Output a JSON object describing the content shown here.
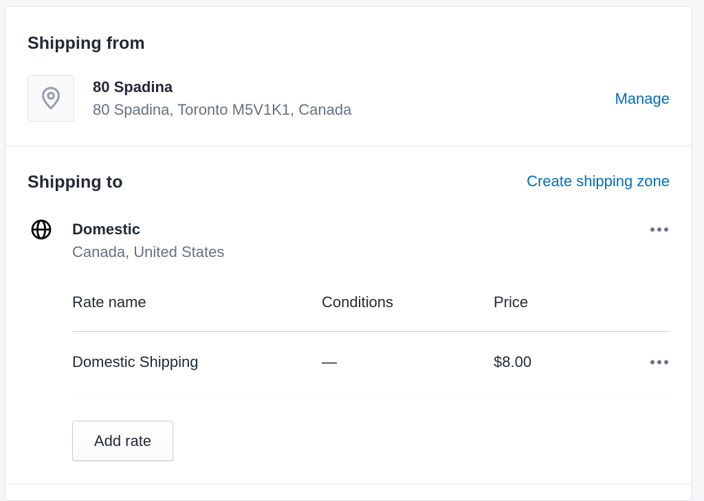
{
  "shipping_from": {
    "heading": "Shipping from",
    "location": {
      "icon": "location-pin-icon",
      "name": "80 Spadina",
      "address": "80 Spadina, Toronto M5V1K1, Canada"
    },
    "manage_label": "Manage"
  },
  "shipping_to": {
    "heading": "Shipping to",
    "create_zone_label": "Create shipping zone",
    "zones": [
      {
        "icon": "globe-icon",
        "name": "Domestic",
        "countries": "Canada, United States",
        "columns": {
          "rate_name": "Rate name",
          "conditions": "Conditions",
          "price": "Price"
        },
        "rates": [
          {
            "name": "Domestic Shipping",
            "conditions": "—",
            "price": "$8.00"
          }
        ],
        "add_rate_label": "Add rate"
      }
    ]
  },
  "colors": {
    "link": "#006fbb",
    "text": "#212b36",
    "subdued": "#637381",
    "border": "#dfe3e8"
  }
}
